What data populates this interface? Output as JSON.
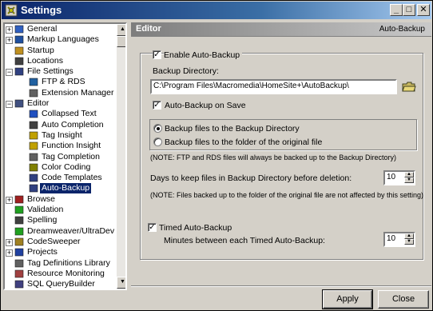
{
  "window": {
    "title": "Settings",
    "controls": {
      "minimize": "_",
      "maximize": "□",
      "close": "✕"
    }
  },
  "tree": {
    "items": [
      {
        "label": "General",
        "exp": "+",
        "icon": "globe-icon"
      },
      {
        "label": "Markup Languages",
        "exp": "+",
        "icon": "markup-icon"
      },
      {
        "label": "Startup",
        "exp": "",
        "icon": "startup-icon"
      },
      {
        "label": "Locations",
        "exp": "",
        "icon": "locations-icon"
      },
      {
        "label": "File Settings",
        "exp": "−",
        "icon": "file-settings-icon"
      },
      {
        "label": "FTP & RDS",
        "exp": "",
        "icon": "ftp-icon",
        "child": true
      },
      {
        "label": "Extension Manager",
        "exp": "",
        "icon": "extension-icon",
        "child": true
      },
      {
        "label": "Editor",
        "exp": "−",
        "icon": "editor-icon"
      },
      {
        "label": "Collapsed Text",
        "exp": "",
        "icon": "collapsed-text-icon",
        "child": true
      },
      {
        "label": "Auto Completion",
        "exp": "",
        "icon": "auto-completion-icon",
        "child": true
      },
      {
        "label": "Tag Insight",
        "exp": "",
        "icon": "bulb-icon",
        "child": true
      },
      {
        "label": "Function Insight",
        "exp": "",
        "icon": "bulb-icon",
        "child": true
      },
      {
        "label": "Tag Completion",
        "exp": "",
        "icon": "tag-completion-icon",
        "child": true
      },
      {
        "label": "Color Coding",
        "exp": "",
        "icon": "color-coding-icon",
        "child": true
      },
      {
        "label": "Code Templates",
        "exp": "",
        "icon": "code-templates-icon",
        "child": true
      },
      {
        "label": "Auto-Backup",
        "exp": "",
        "icon": "auto-backup-icon",
        "child": true,
        "selected": true
      },
      {
        "label": "Browse",
        "exp": "+",
        "icon": "browse-icon"
      },
      {
        "label": "Validation",
        "exp": "",
        "icon": "validation-icon"
      },
      {
        "label": "Spelling",
        "exp": "",
        "icon": "spelling-icon"
      },
      {
        "label": "Dreamweaver/UltraDev",
        "exp": "",
        "icon": "dreamweaver-icon"
      },
      {
        "label": "CodeSweeper",
        "exp": "+",
        "icon": "codesweeper-icon"
      },
      {
        "label": "Projects",
        "exp": "+",
        "icon": "projects-icon"
      },
      {
        "label": "Tag Definitions Library",
        "exp": "",
        "icon": "tag-library-icon"
      },
      {
        "label": "Resource Monitoring",
        "exp": "",
        "icon": "resource-icon"
      },
      {
        "label": "SQL QueryBuilder",
        "exp": "",
        "icon": "sql-icon"
      }
    ],
    "scroll_up": "▲",
    "scroll_down": "▼"
  },
  "header": {
    "left": "Editor",
    "right": "Auto-Backup"
  },
  "form": {
    "enable_label": "Enable Auto-Backup",
    "enable_checked": "✓",
    "backup_dir_label": "Backup Directory:",
    "backup_dir_value": "C:\\Program Files\\Macromedia\\HomeSite+\\AutoBackup\\",
    "auto_save_label": "Auto-Backup on Save",
    "auto_save_checked": "✓",
    "radio_backup_dir": "Backup files to the Backup Directory",
    "radio_original": "Backup files to the folder of the original file",
    "note_ftp": "(NOTE: FTP and RDS files will always be backed up to the Backup Directory)",
    "days_label": "Days to keep files in Backup Directory before deletion:",
    "days_value": "10",
    "note_original": "(NOTE: Files backed up to the folder of the original file are not affected by this setting)",
    "timed_label": "Timed Auto-Backup",
    "timed_checked": "✓",
    "minutes_label": "Minutes between each Timed Auto-Backup:",
    "minutes_value": "10",
    "spin_up": "▲",
    "spin_down": "▼"
  },
  "buttons": {
    "apply": "Apply",
    "close": "Close"
  }
}
